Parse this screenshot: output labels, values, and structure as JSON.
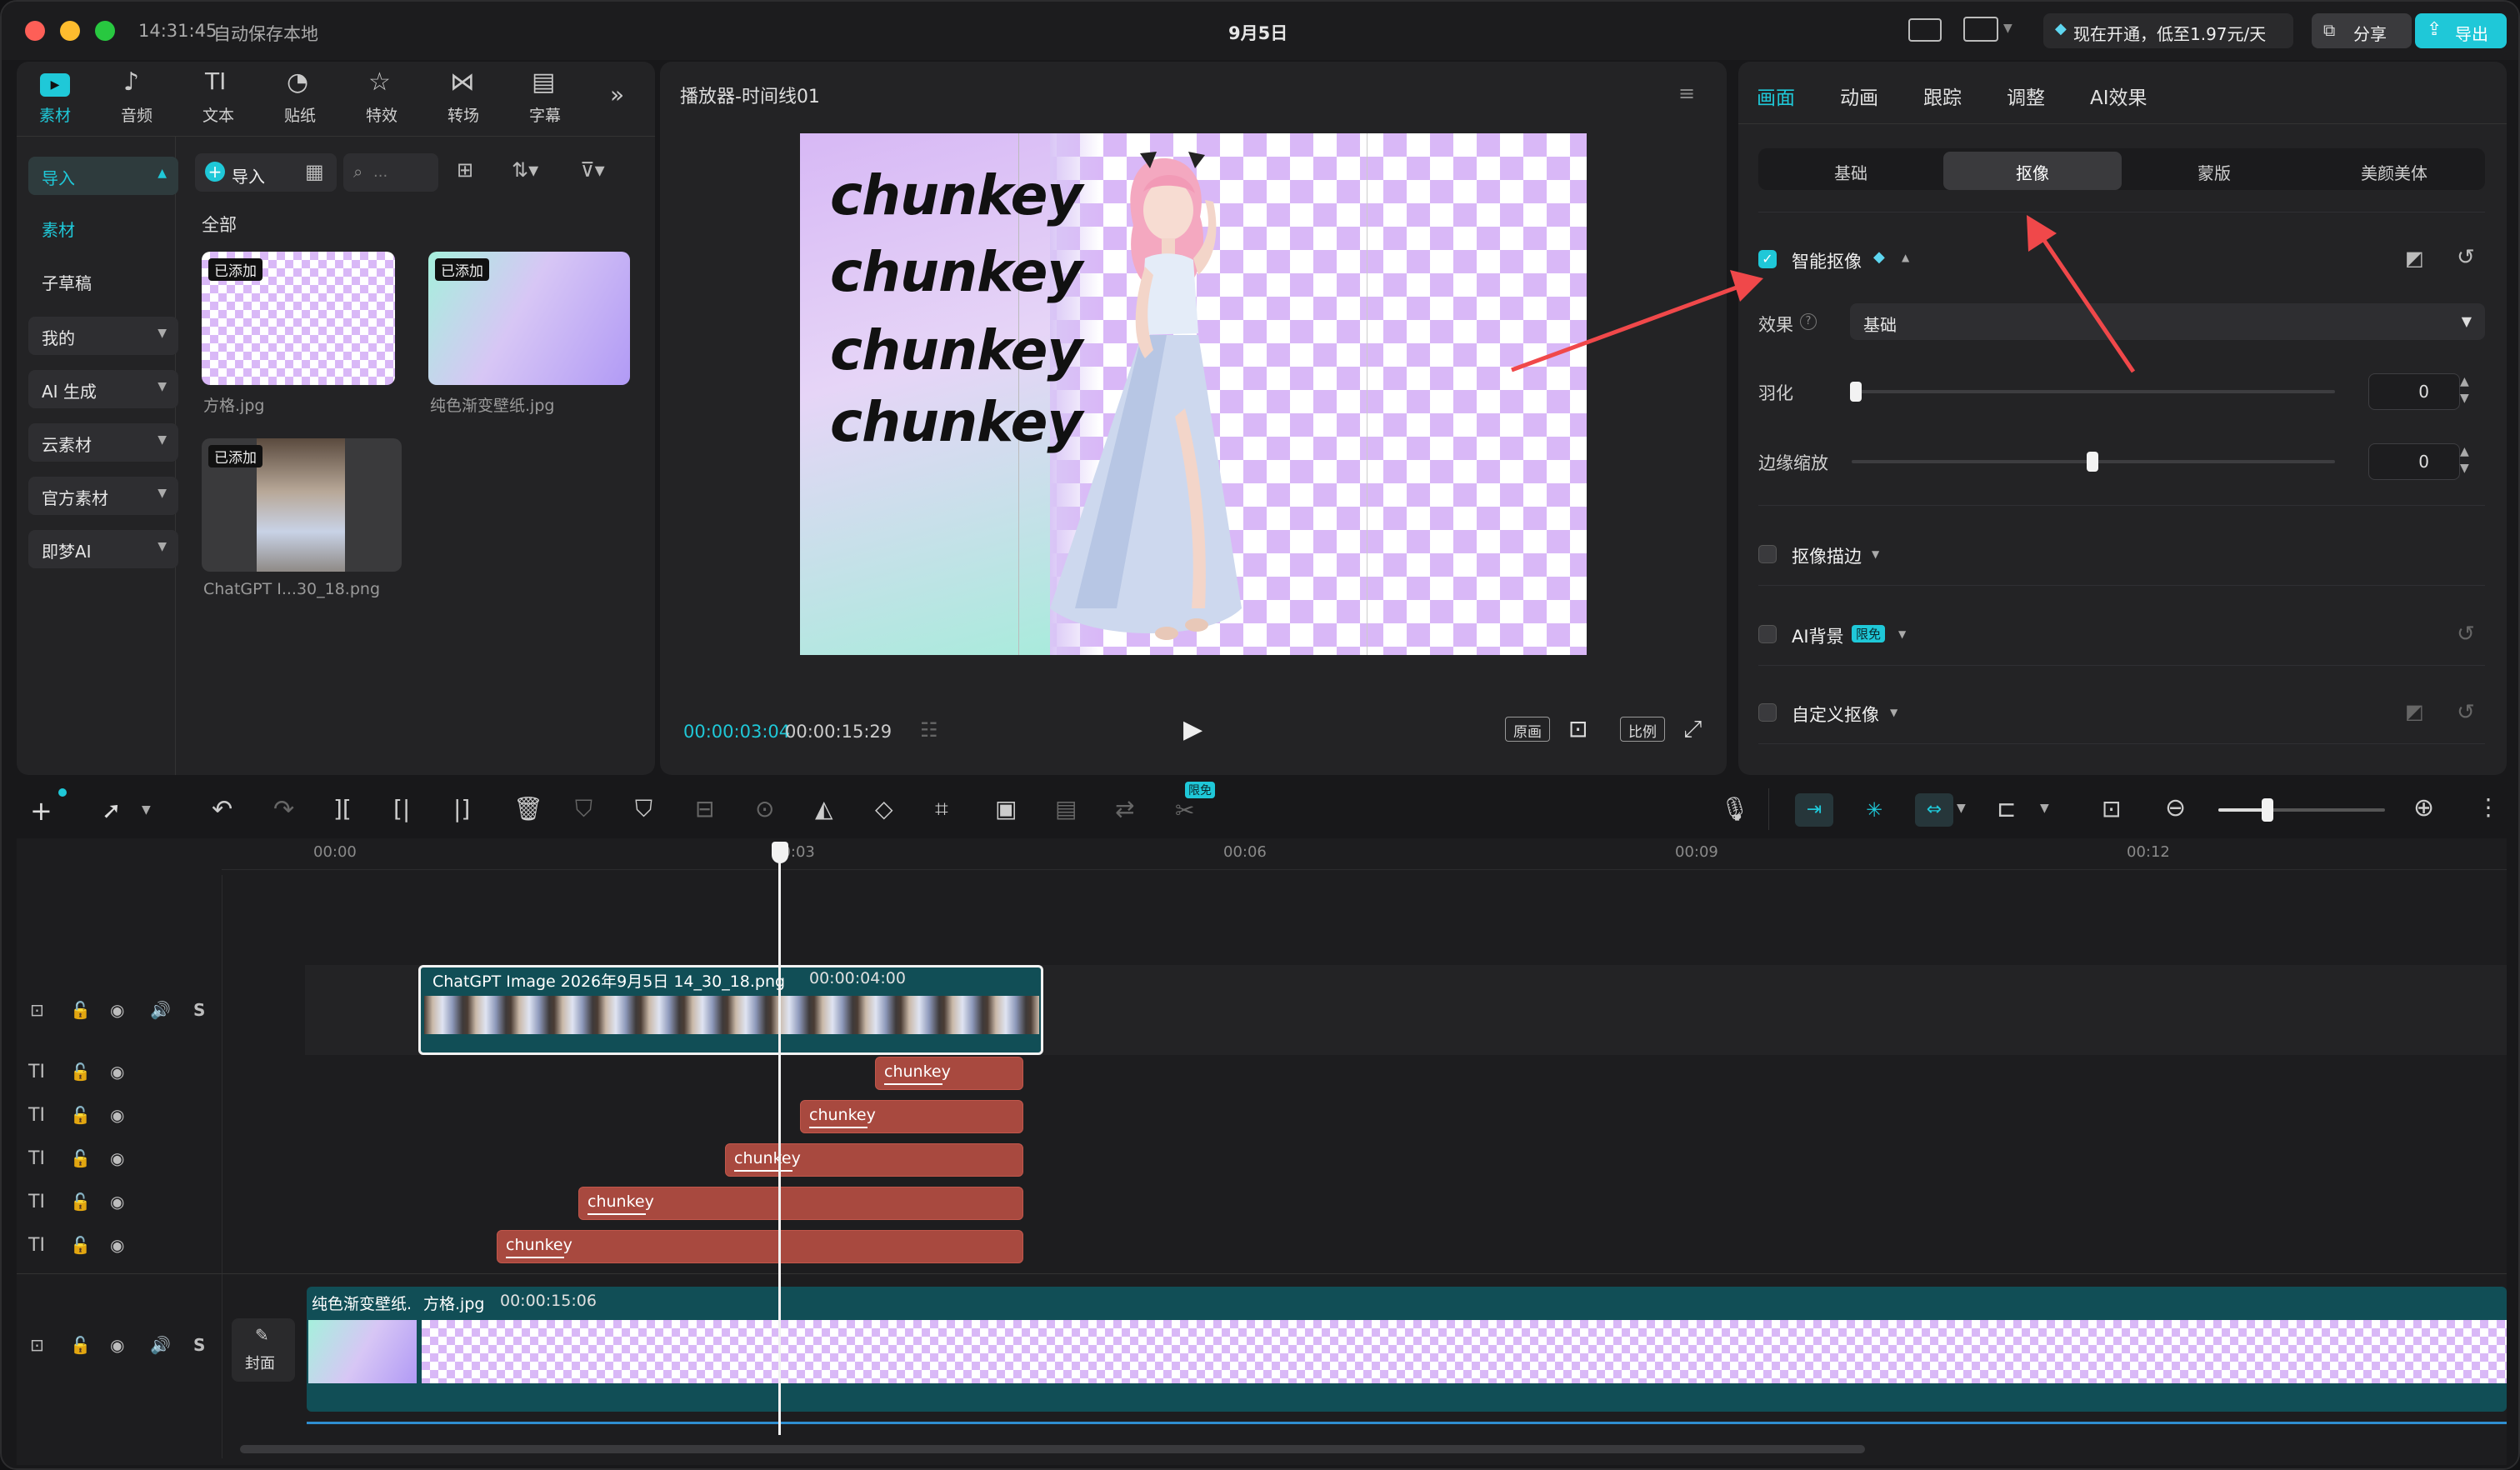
{
  "titlebar": {
    "time": "14:31:45",
    "autosave": "自动保存本地",
    "center_title": "9月5日",
    "promo": "现在开通，低至1.97元/天",
    "share": "分享",
    "export": "导出"
  },
  "media_tabs": [
    {
      "label": "素材"
    },
    {
      "label": "音频"
    },
    {
      "label": "文本"
    },
    {
      "label": "贴纸"
    },
    {
      "label": "特效"
    },
    {
      "label": "转场"
    },
    {
      "label": "字幕"
    }
  ],
  "sidebar": {
    "import": "导入",
    "material": "素材",
    "subdraft": "子草稿",
    "items": [
      {
        "label": "我的"
      },
      {
        "label": "AI 生成"
      },
      {
        "label": "云素材"
      },
      {
        "label": "官方素材"
      },
      {
        "label": "即梦AI"
      }
    ]
  },
  "library": {
    "import_btn": "导入",
    "search_placeholder": "...",
    "section": "全部",
    "added_badge": "已添加",
    "files": [
      {
        "name": "方格.jpg"
      },
      {
        "name": "纯色渐变壁纸.jpg"
      },
      {
        "name": "ChatGPT I...30_18.png"
      }
    ]
  },
  "player": {
    "title": "播放器-时间线01",
    "current": "00:00:03:04",
    "total": "00:00:15:29",
    "btn_original": "原画",
    "btn_ratio": "比例",
    "canvas_texts": [
      "chunkey",
      "chunkey",
      "chunkey",
      "chunkey"
    ]
  },
  "inspector": {
    "tabs": [
      {
        "label": "画面"
      },
      {
        "label": "动画"
      },
      {
        "label": "跟踪"
      },
      {
        "label": "调整"
      },
      {
        "label": "AI效果"
      }
    ],
    "sub_tabs": [
      {
        "label": "基础"
      },
      {
        "label": "抠像"
      },
      {
        "label": "蒙版"
      },
      {
        "label": "美颜美体"
      }
    ],
    "smart_cutout": "智能抠像",
    "effect_label": "效果",
    "effect_value": "基础",
    "feather_label": "羽化",
    "feather_value": "0",
    "edge_label": "边缘缩放",
    "edge_value": "0",
    "stroke_label": "抠像描边",
    "ai_bg_label": "AI背景",
    "ai_bg_badge": "限免",
    "custom_label": "自定义抠像"
  },
  "accent": "#1fc8d8",
  "toolbar": {
    "free_badge": "限免"
  },
  "ruler": {
    "marks": [
      "00:00",
      "00:03",
      "00:06",
      "00:09",
      "00:12"
    ]
  },
  "timeline": {
    "main_clip_name": "ChatGPT Image 2026年9月5日 14_30_18.png",
    "main_clip_dur": "00:00:04:00",
    "text_clips": [
      "chunkey",
      "chunkey",
      "chunkey",
      "chunkey",
      "chunkey"
    ],
    "bg_clip_1": "纯色渐变壁纸.",
    "bg_clip_2": "方格.jpg",
    "bg_clip_dur": "00:00:15:06",
    "cover_label": "封面",
    "solo": "S"
  }
}
